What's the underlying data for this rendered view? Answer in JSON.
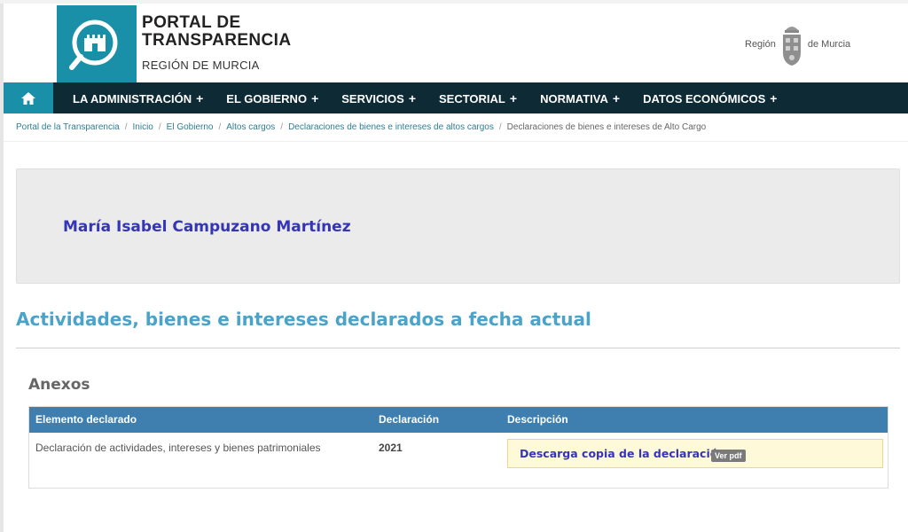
{
  "brand": {
    "title_line1": "PORTAL DE",
    "title_line2": "TRANSPARENCIA",
    "subtitle": "REGIÓN DE MURCIA",
    "region_left": "Región",
    "region_right": "de Murcia"
  },
  "nav": {
    "items": [
      {
        "label": "LA ADMINISTRACIÓN"
      },
      {
        "label": "EL GOBIERNO"
      },
      {
        "label": "SERVICIOS"
      },
      {
        "label": "SECTORIAL"
      },
      {
        "label": "NORMATIVA"
      },
      {
        "label": "DATOS ECONÓMICOS"
      }
    ],
    "plus": "+"
  },
  "breadcrumb": {
    "items": [
      "Portal de la Transparencia",
      "Inicio",
      "El Gobierno",
      "Altos cargos",
      "Declaraciones de bienes e intereses de altos cargos"
    ],
    "current": "Declaraciones de bienes e intereses de Alto Cargo",
    "separator": "/"
  },
  "person": {
    "name": "María Isabel Campuzano Martínez"
  },
  "section": {
    "heading": "Actividades, bienes e intereses declarados a fecha actual"
  },
  "annex": {
    "title": "Anexos",
    "columns": [
      "Elemento declarado",
      "Declaración",
      "Descripción"
    ],
    "row": {
      "element": "Declaración de actividades, intereses y bienes patrimoniales",
      "year": "2021",
      "link": "Descarga copia de la declaración",
      "badge": "Ver pdf"
    }
  },
  "colors": {
    "nav_bg": "#0d2a35",
    "brand_teal": "#1a90a8",
    "table_header": "#3f7fb0",
    "link_blue": "#3535b8",
    "heading_blue": "#4aa3c8"
  }
}
